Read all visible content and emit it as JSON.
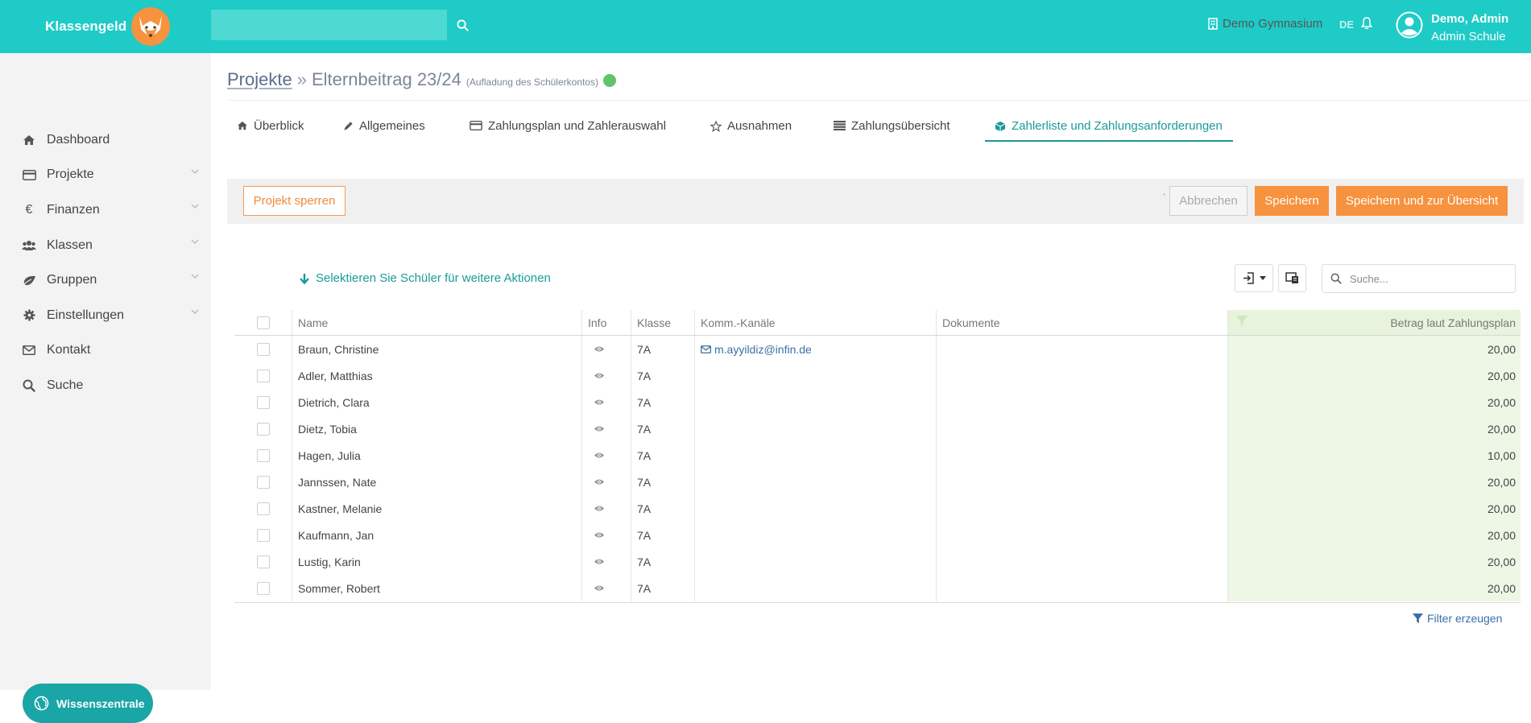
{
  "app": {
    "name": "Klassengeld",
    "brand_color": "#1ecbc6",
    "accent_color": "#f7923e"
  },
  "topbar": {
    "search_placeholder": "",
    "school": "Demo Gymnasium",
    "lang": "DE",
    "user_name": "Demo, Admin",
    "user_role": "Admin Schule"
  },
  "sidebar": {
    "items": [
      {
        "label": "Dashboard",
        "icon": "home-icon",
        "expandable": false
      },
      {
        "label": "Projekte",
        "icon": "credit-card-icon",
        "expandable": true
      },
      {
        "label": "Finanzen",
        "icon": "euro-icon",
        "expandable": true
      },
      {
        "label": "Klassen",
        "icon": "users-icon",
        "expandable": true
      },
      {
        "label": "Gruppen",
        "icon": "leaf-icon",
        "expandable": true
      },
      {
        "label": "Einstellungen",
        "icon": "gear-icon",
        "expandable": true
      },
      {
        "label": "Kontakt",
        "icon": "envelope-icon",
        "expandable": false
      },
      {
        "label": "Suche",
        "icon": "search-icon",
        "expandable": false
      }
    ],
    "wissen_label": "Wissenszentrale"
  },
  "breadcrumb": {
    "root": "Projekte",
    "sep": "»",
    "title": "Elternbeitrag 23/24",
    "subtitle": "(Aufladung des Schülerkontos)"
  },
  "tabs": [
    {
      "label": "Überblick",
      "icon": "home-icon",
      "active": false
    },
    {
      "label": "Allgemeines",
      "icon": "pencil-icon",
      "active": false
    },
    {
      "label": "Zahlungsplan und Zahlerauswahl",
      "icon": "credit-card-icon",
      "active": false
    },
    {
      "label": "Ausnahmen",
      "icon": "star-icon",
      "active": false
    },
    {
      "label": "Zahlungsübersicht",
      "icon": "list-icon",
      "active": false
    },
    {
      "label": "Zahlerliste und Zahlungsanforderungen",
      "icon": "cube-icon",
      "active": true
    }
  ],
  "toolbar": {
    "lock_label": "Projekt sperren",
    "tick": "`",
    "cancel_label": "Abbrechen",
    "save_label": "Speichern",
    "save_overview_label": "Speichern und zur Übersicht"
  },
  "list": {
    "select_hint": "Selektieren Sie Schüler für weitere Aktionen",
    "search_placeholder": "Suche...",
    "filter_label": "Filter erzeugen"
  },
  "table": {
    "headers": {
      "name": "Name",
      "info": "Info",
      "klasse": "Klasse",
      "komm": "Komm.-Kanäle",
      "doc": "Dokumente",
      "betrag": "Betrag laut Zahlungsplan"
    },
    "rows": [
      {
        "name": "Braun, Christine",
        "klasse": "7A",
        "email": "m.ayyildiz@infin.de",
        "betrag": "20,00"
      },
      {
        "name": "Adler, Matthias",
        "klasse": "7A",
        "email": "",
        "betrag": "20,00"
      },
      {
        "name": "Dietrich, Clara",
        "klasse": "7A",
        "email": "",
        "betrag": "20,00"
      },
      {
        "name": "Dietz, Tobia",
        "klasse": "7A",
        "email": "",
        "betrag": "20,00"
      },
      {
        "name": "Hagen, Julia",
        "klasse": "7A",
        "email": "",
        "betrag": "10,00"
      },
      {
        "name": "Jannssen, Nate",
        "klasse": "7A",
        "email": "",
        "betrag": "20,00"
      },
      {
        "name": "Kastner, Melanie",
        "klasse": "7A",
        "email": "",
        "betrag": "20,00"
      },
      {
        "name": "Kaufmann, Jan",
        "klasse": "7A",
        "email": "",
        "betrag": "20,00"
      },
      {
        "name": "Lustig, Karin",
        "klasse": "7A",
        "email": "",
        "betrag": "20,00"
      },
      {
        "name": "Sommer, Robert",
        "klasse": "7A",
        "email": "",
        "betrag": "20,00"
      }
    ]
  }
}
